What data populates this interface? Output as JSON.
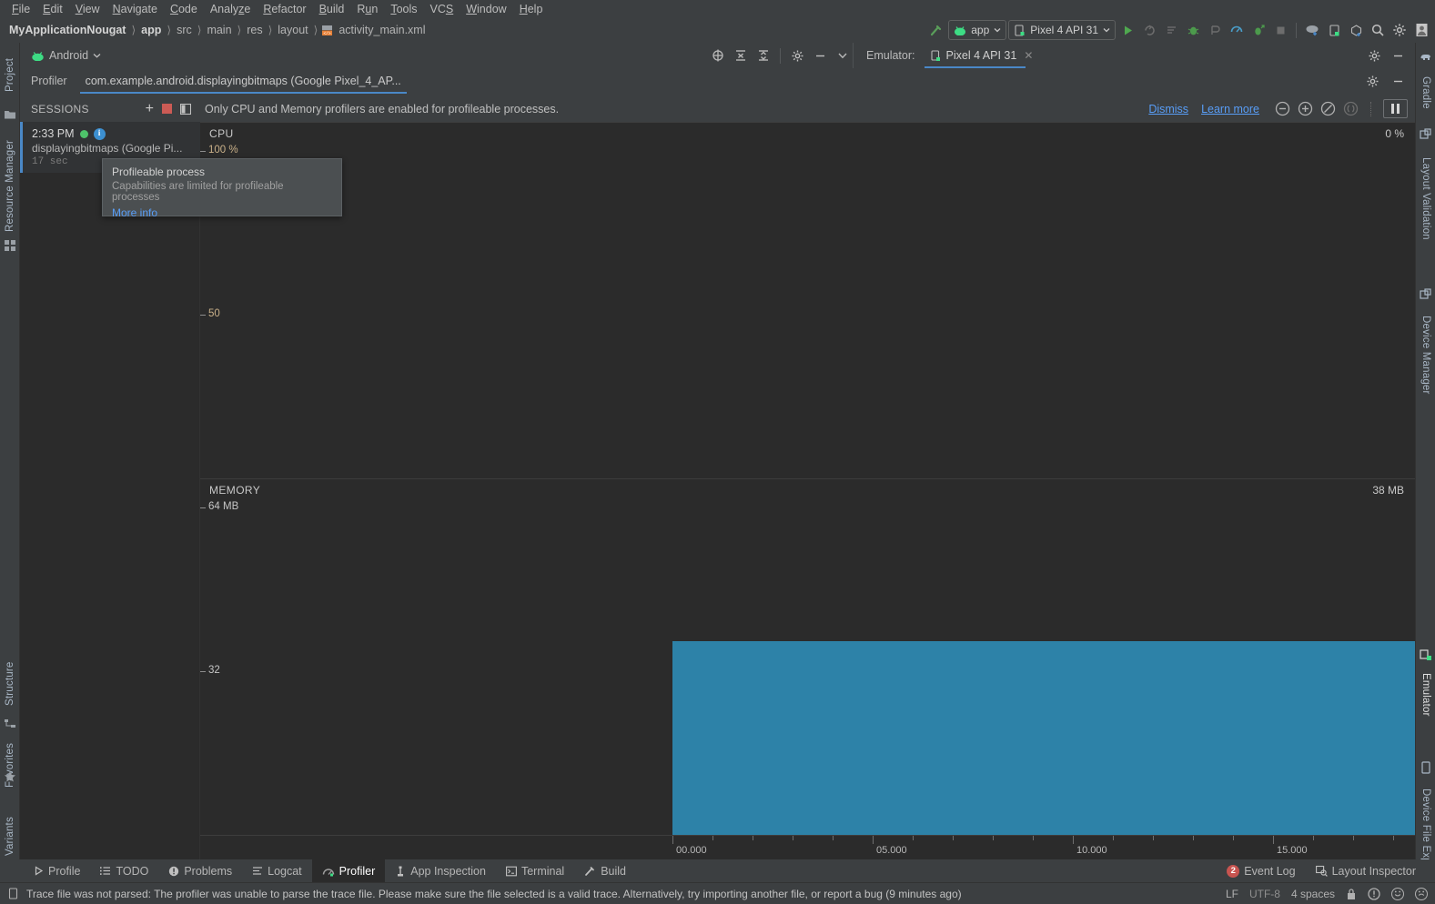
{
  "menu": {
    "items": [
      "File",
      "Edit",
      "View",
      "Navigate",
      "Code",
      "Analyze",
      "Refactor",
      "Build",
      "Run",
      "Tools",
      "VCS",
      "Window",
      "Help"
    ]
  },
  "breadcrumb": {
    "project": "MyApplicationNougat",
    "items": [
      "app",
      "src",
      "main",
      "res",
      "layout"
    ],
    "file": "activity_main.xml",
    "separator": "〉"
  },
  "toolbar": {
    "run_config": "app",
    "device": "Pixel 4 API 31",
    "icons": [
      "hammer-icon",
      "run-icon",
      "apply-changes-icon",
      "apply-code-changes-icon",
      "debug-icon",
      "attach-debugger-icon",
      "profile-icon",
      "profile-debug-icon",
      "stop-icon",
      "sync-gradle-icon",
      "avd-manager-icon",
      "sdk-manager-icon",
      "search-icon",
      "settings-icon",
      "account-icon"
    ]
  },
  "left_strip": {
    "tabs": [
      "Project",
      "Resource Manager",
      "Structure",
      "Favorites",
      "Build Variants"
    ]
  },
  "right_strip": {
    "tabs": [
      "Gradle",
      "Layout Validation",
      "Device Manager",
      "Emulator",
      "Device File Explorer"
    ]
  },
  "tool_window": {
    "title": "Android",
    "emulator_label": "Emulator:",
    "emulator_tab": "Pixel 4 API 31"
  },
  "profiler": {
    "label": "Profiler",
    "tab": "com.example.android.displayingbitmaps (Google Pixel_4_AP..."
  },
  "sessions": {
    "header": "SESSIONS",
    "add_label": "+",
    "items": [
      {
        "time": "2:33 PM",
        "name": "displayingbitmaps (Google Pi...",
        "duration": "17 sec"
      }
    ]
  },
  "banner": {
    "message": "Only CPU and Memory profilers are enabled for profileable processes.",
    "dismiss": "Dismiss",
    "learn_more": "Learn more"
  },
  "tooltip": {
    "title": "Profileable process",
    "subtitle": "Capabilities are limited for profileable processes",
    "link": "More info"
  },
  "chart_data": [
    {
      "type": "line",
      "title": "CPU",
      "ylabel": "%",
      "current_value": "0 %",
      "axis_ticks": [
        "100 %",
        "50"
      ],
      "ylim": [
        0,
        100
      ],
      "series": [
        {
          "name": "cpu",
          "values": [
            0,
            0,
            0,
            0,
            0,
            0,
            0,
            0
          ]
        }
      ],
      "grid": false
    },
    {
      "type": "area",
      "title": "MEMORY",
      "ylabel": "MB",
      "current_value": "38 MB",
      "axis_ticks": [
        "64 MB",
        "32"
      ],
      "ylim": [
        0,
        64
      ],
      "series": [
        {
          "name": "total",
          "values": [
            0,
            0,
            0,
            0,
            0,
            0,
            0,
            0,
            0,
            0,
            0,
            38,
            38,
            38,
            38,
            38,
            38,
            38,
            38,
            38
          ]
        }
      ],
      "fill_color": "#2d82a8",
      "grid": false
    }
  ],
  "timeline": {
    "labels": [
      "00.000",
      "05.000",
      "10.000",
      "15.000"
    ]
  },
  "bottom_bar": {
    "tabs": [
      {
        "label": "Profile",
        "icon": "play-icon",
        "active": false
      },
      {
        "label": "TODO",
        "icon": "list-icon",
        "active": false
      },
      {
        "label": "Problems",
        "icon": "error-icon",
        "active": false
      },
      {
        "label": "Logcat",
        "icon": "logcat-icon",
        "active": false
      },
      {
        "label": "Profiler",
        "icon": "profiler-icon",
        "active": true
      },
      {
        "label": "App Inspection",
        "icon": "inspection-icon",
        "active": false
      },
      {
        "label": "Terminal",
        "icon": "terminal-icon",
        "active": false
      },
      {
        "label": "Build",
        "icon": "hammer-icon",
        "active": false
      }
    ],
    "right": [
      {
        "label": "Event Log",
        "badge": "2",
        "icon": "event-log-icon"
      },
      {
        "label": "Layout Inspector",
        "badge": "",
        "icon": "layout-inspector-icon"
      }
    ]
  },
  "status_bar": {
    "message": "Trace file was not parsed: The profiler was unable to parse the trace file. Please make sure the file selected is a valid trace. Alternatively, try importing another file, or report a bug (9 minutes ago)",
    "line_separator": "LF",
    "encoding": "UTF-8",
    "indent": "4 spaces",
    "icons": [
      "lock-icon",
      "inspection-icon",
      "smiley-icon",
      "frowny-icon"
    ]
  }
}
